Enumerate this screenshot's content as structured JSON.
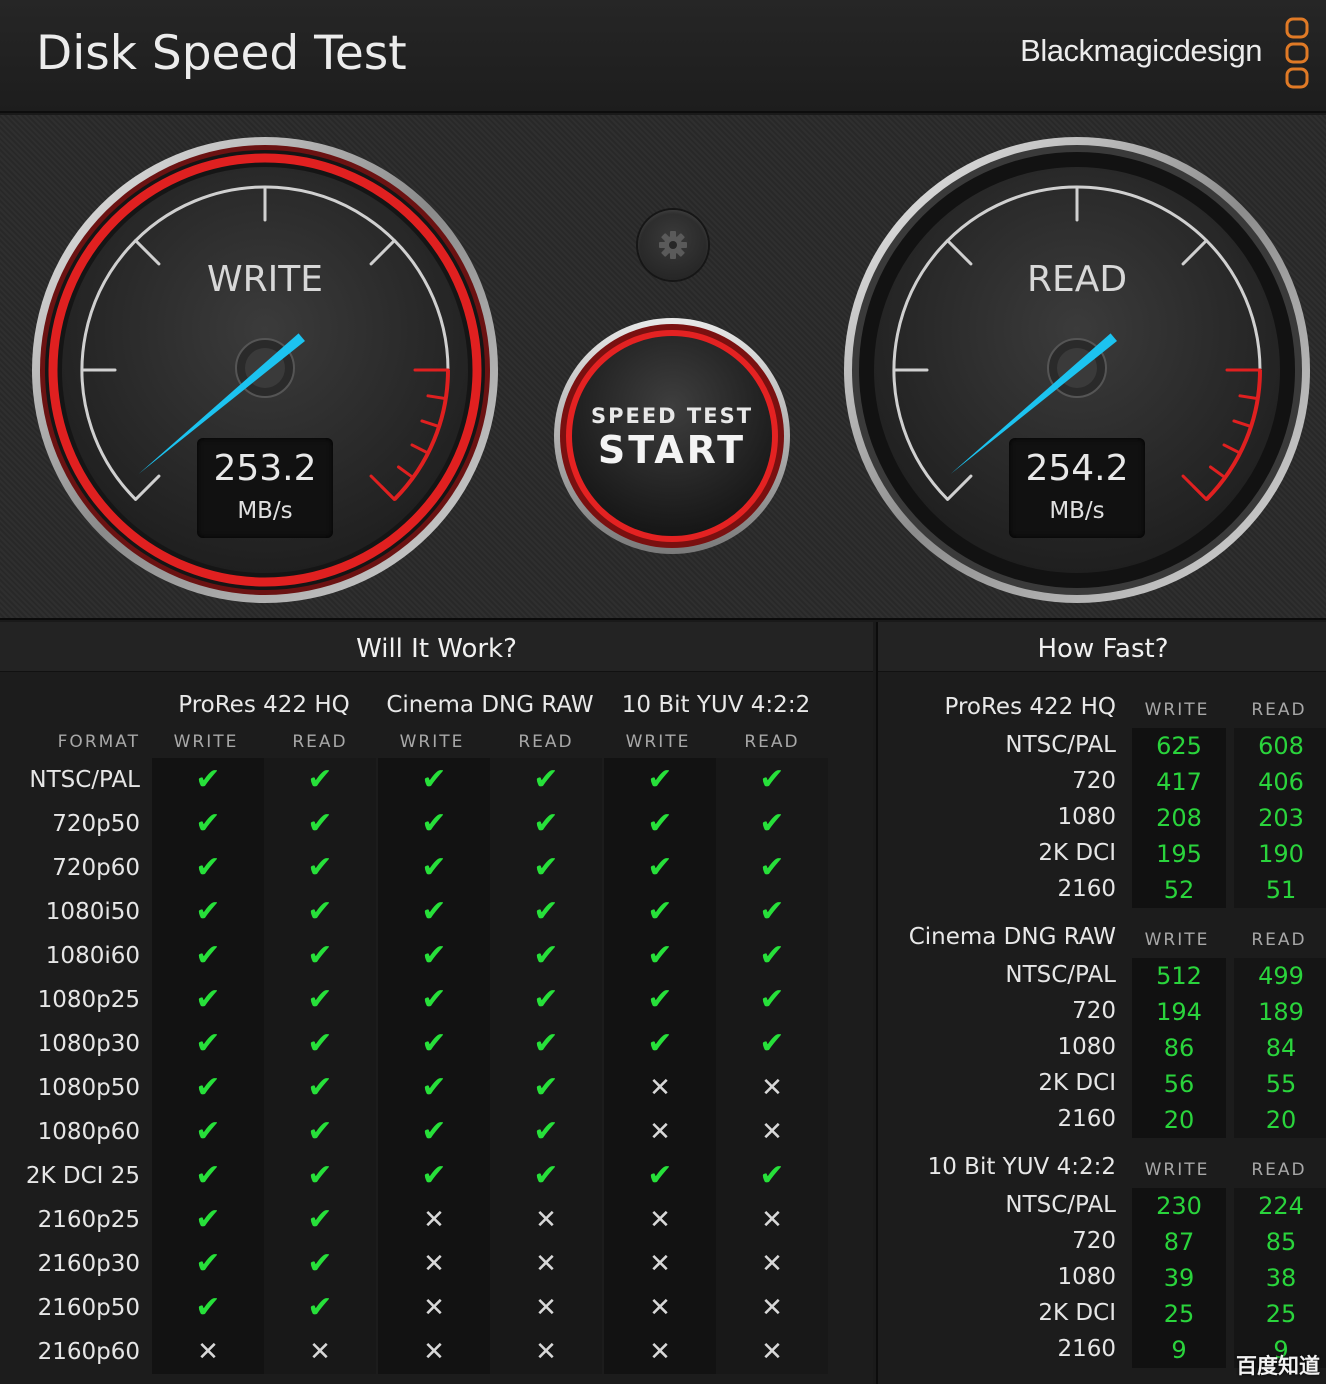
{
  "header": {
    "title": "Disk Speed Test",
    "brand": "Blackmagicdesign"
  },
  "gauges": {
    "write": {
      "label": "WRITE",
      "value": "253.2",
      "unit": "MB/s"
    },
    "read": {
      "label": "READ",
      "value": "254.2",
      "unit": "MB/s"
    }
  },
  "start_button": {
    "line1": "SPEED TEST",
    "line2": "START"
  },
  "settings_icon": "gear-icon",
  "colors": {
    "accent_red": "#e02020",
    "needle": "#1cc3f0",
    "ok_green": "#27e03a",
    "value_green": "#2ad43c",
    "brand_orange": "#e07a26"
  },
  "will_it_work": {
    "title": "Will It Work?",
    "format_label": "FORMAT",
    "codecs": [
      "ProRes 422 HQ",
      "Cinema DNG RAW",
      "10 Bit YUV 4:2:2"
    ],
    "write_label": "WRITE",
    "read_label": "READ",
    "symbols": {
      "ok": "✔",
      "no": "✕"
    },
    "rows": [
      {
        "format": "NTSC/PAL",
        "results": [
          1,
          1,
          1,
          1,
          1,
          1
        ]
      },
      {
        "format": "720p50",
        "results": [
          1,
          1,
          1,
          1,
          1,
          1
        ]
      },
      {
        "format": "720p60",
        "results": [
          1,
          1,
          1,
          1,
          1,
          1
        ]
      },
      {
        "format": "1080i50",
        "results": [
          1,
          1,
          1,
          1,
          1,
          1
        ]
      },
      {
        "format": "1080i60",
        "results": [
          1,
          1,
          1,
          1,
          1,
          1
        ]
      },
      {
        "format": "1080p25",
        "results": [
          1,
          1,
          1,
          1,
          1,
          1
        ]
      },
      {
        "format": "1080p30",
        "results": [
          1,
          1,
          1,
          1,
          1,
          1
        ]
      },
      {
        "format": "1080p50",
        "results": [
          1,
          1,
          1,
          1,
          0,
          0
        ]
      },
      {
        "format": "1080p60",
        "results": [
          1,
          1,
          1,
          1,
          0,
          0
        ]
      },
      {
        "format": "2K DCI 25",
        "results": [
          1,
          1,
          1,
          1,
          1,
          1
        ]
      },
      {
        "format": "2160p25",
        "results": [
          1,
          1,
          0,
          0,
          0,
          0
        ]
      },
      {
        "format": "2160p30",
        "results": [
          1,
          1,
          0,
          0,
          0,
          0
        ]
      },
      {
        "format": "2160p50",
        "results": [
          1,
          1,
          0,
          0,
          0,
          0
        ]
      },
      {
        "format": "2160p60",
        "results": [
          0,
          0,
          0,
          0,
          0,
          0
        ]
      }
    ]
  },
  "how_fast": {
    "title": "How Fast?",
    "write_label": "WRITE",
    "read_label": "READ",
    "groups": [
      {
        "codec": "ProRes 422 HQ",
        "rows": [
          {
            "format": "NTSC/PAL",
            "write": "625",
            "read": "608"
          },
          {
            "format": "720",
            "write": "417",
            "read": "406"
          },
          {
            "format": "1080",
            "write": "208",
            "read": "203"
          },
          {
            "format": "2K DCI",
            "write": "195",
            "read": "190"
          },
          {
            "format": "2160",
            "write": "52",
            "read": "51"
          }
        ]
      },
      {
        "codec": "Cinema DNG RAW",
        "rows": [
          {
            "format": "NTSC/PAL",
            "write": "512",
            "read": "499"
          },
          {
            "format": "720",
            "write": "194",
            "read": "189"
          },
          {
            "format": "1080",
            "write": "86",
            "read": "84"
          },
          {
            "format": "2K DCI",
            "write": "56",
            "read": "55"
          },
          {
            "format": "2160",
            "write": "20",
            "read": "20"
          }
        ]
      },
      {
        "codec": "10 Bit YUV 4:2:2",
        "rows": [
          {
            "format": "NTSC/PAL",
            "write": "230",
            "read": "224"
          },
          {
            "format": "720",
            "write": "87",
            "read": "85"
          },
          {
            "format": "1080",
            "write": "39",
            "read": "38"
          },
          {
            "format": "2K DCI",
            "write": "25",
            "read": "25"
          },
          {
            "format": "2160",
            "write": "9",
            "read": "9"
          }
        ]
      }
    ]
  },
  "watermark": "百度知道"
}
